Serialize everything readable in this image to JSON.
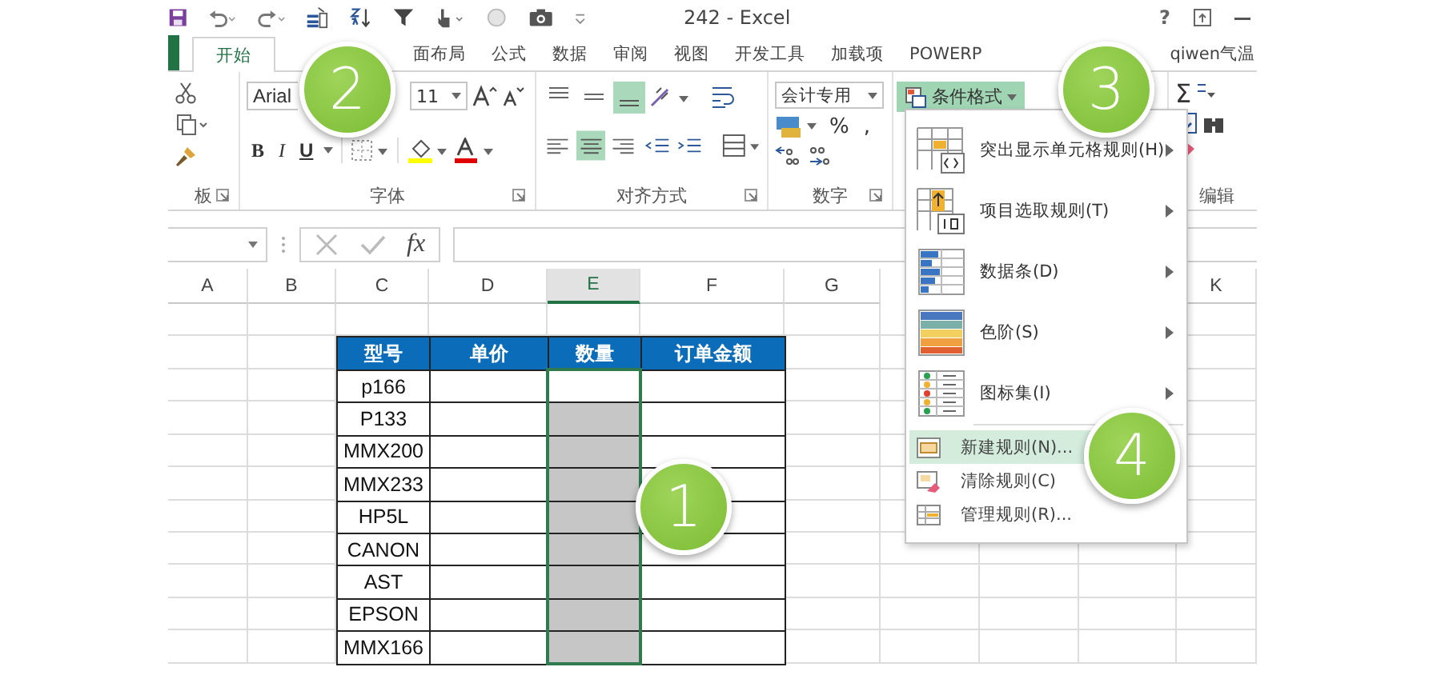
{
  "window": {
    "title": "242 - Excel",
    "help": "?"
  },
  "tabs": [
    {
      "label": "开始",
      "selected": true
    },
    {
      "label": "面布局",
      "selected": false
    },
    {
      "label": "公式",
      "selected": false
    },
    {
      "label": "数据",
      "selected": false
    },
    {
      "label": "审阅",
      "selected": false
    },
    {
      "label": "视图",
      "selected": false
    },
    {
      "label": "开发工具",
      "selected": false
    },
    {
      "label": "加载项",
      "selected": false
    },
    {
      "label": "POWERP",
      "selected": false
    },
    {
      "label": "qiwen气温",
      "selected": false
    }
  ],
  "ribbon": {
    "font_name": "Arial",
    "font_size": "11",
    "format_buttons": [
      "B",
      "I",
      "U"
    ],
    "number_format": "会计专用",
    "number_symbols": [
      "%",
      ","
    ],
    "conditional_format": {
      "label": "条件格式",
      "expanded": true
    },
    "autosum": "Σ",
    "groups": [
      "板",
      "字体",
      "对齐方式",
      "数字",
      "编辑"
    ]
  },
  "formula_bar": {
    "function_label": "fx"
  },
  "column_headers": [
    {
      "label": "A",
      "selected": false
    },
    {
      "label": "B",
      "selected": false
    },
    {
      "label": "C",
      "selected": false
    },
    {
      "label": "D",
      "selected": false
    },
    {
      "label": "E",
      "selected": true
    },
    {
      "label": "F",
      "selected": false
    },
    {
      "label": "G",
      "selected": false
    },
    {
      "label": "K",
      "selected": false
    }
  ],
  "table": {
    "columns": [
      "型号",
      "单价",
      "数量",
      "订单金额"
    ],
    "rows": [
      {
        "model": "p166",
        "quantity_selected": false
      },
      {
        "model": "P133",
        "quantity_selected": true
      },
      {
        "model": "MMX200",
        "quantity_selected": true
      },
      {
        "model": "MMX233",
        "quantity_selected": true
      },
      {
        "model": "HP5L",
        "quantity_selected": true
      },
      {
        "model": "CANON",
        "quantity_selected": true
      },
      {
        "model": "AST",
        "quantity_selected": true
      },
      {
        "model": "EPSON",
        "quantity_selected": true
      },
      {
        "model": "MMX166",
        "quantity_selected": true
      }
    ]
  },
  "menu": {
    "items": [
      {
        "kind": "highlight",
        "label": "突出显示单元格规则(H)",
        "submenu": true,
        "selected": false
      },
      {
        "kind": "top",
        "label": "项目选取规则(T)",
        "submenu": true,
        "selected": false
      },
      {
        "kind": "databar",
        "label": "数据条(D)",
        "submenu": true,
        "selected": false
      },
      {
        "kind": "colorscale",
        "label": "色阶(S)",
        "submenu": true,
        "selected": false
      },
      {
        "kind": "iconset",
        "label": "图标集(I)",
        "submenu": true,
        "selected": false
      },
      {
        "kind": "new",
        "label": "新建规则(N)...",
        "submenu": false,
        "selected": true
      },
      {
        "kind": "clear",
        "label": "清除规则(C)",
        "submenu": false,
        "selected": false
      },
      {
        "kind": "manage",
        "label": "管理规则(R)...",
        "submenu": false,
        "selected": false
      }
    ]
  },
  "callouts": [
    {
      "label": "2",
      "kind": "ribbon-font"
    },
    {
      "label": "3",
      "kind": "ribbon-styles"
    },
    {
      "label": "4",
      "kind": "menu"
    },
    {
      "label": "1",
      "kind": "sheet"
    }
  ]
}
